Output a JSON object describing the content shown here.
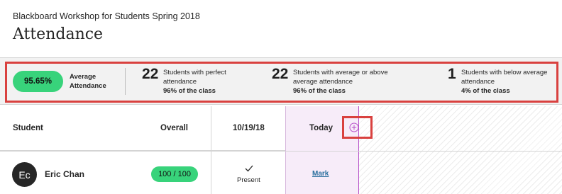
{
  "header": {
    "course_name": "Blackboard Workshop for Students Spring 2018",
    "page_title": "Attendance"
  },
  "summary": {
    "average_value": "95.65%",
    "average_label": "Average Attendance",
    "perfect": {
      "count": "22",
      "text": "Students with perfect attendance",
      "pct": "96% of the class"
    },
    "above": {
      "count": "22",
      "text": "Students with average or above average attendance",
      "pct": "96% of the class"
    },
    "below": {
      "count": "1",
      "text": "Students with below average attendance",
      "pct": "4% of the class"
    }
  },
  "grid": {
    "columns": {
      "student": "Student",
      "overall": "Overall",
      "session_date": "10/19/18",
      "today": "Today"
    },
    "add_column_icon": "plus-circle-icon",
    "rows": [
      {
        "avatar_initials": "Ec",
        "name": "Eric Chan",
        "overall": "100 / 100",
        "session_status": "Present",
        "session_icon": "checkmark-icon",
        "today_action": "Mark"
      }
    ]
  },
  "colors": {
    "accent_green": "#38d37b",
    "today_column_bg": "#f7ecf9",
    "today_column_border": "#b64fc8",
    "highlight_red": "#d9413f",
    "link_blue": "#2a6f9e"
  }
}
